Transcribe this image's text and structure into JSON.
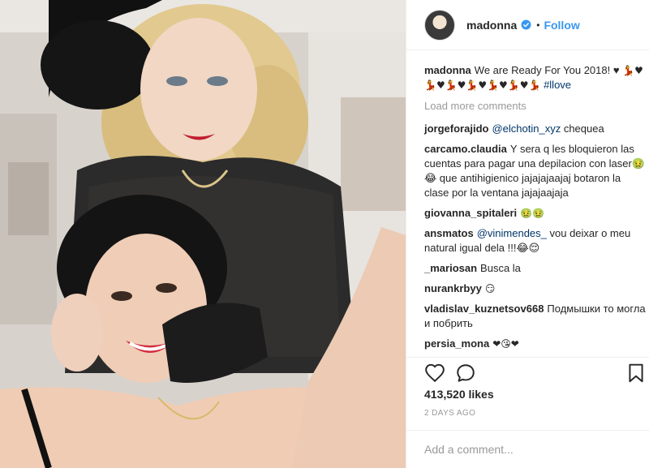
{
  "post": {
    "username": "madonna",
    "separator": "•",
    "follow_label": "Follow",
    "caption_user": "madonna",
    "caption_text": "We are Ready For You 2018! ♥",
    "caption_emojis": "💃♥💃♥💃♥💃♥💃♥💃♥💃",
    "caption_hashtag": "#llove",
    "load_more": "Load more comments",
    "likes": "413,520 likes",
    "time": "2 DAYS AGO",
    "add_comment_placeholder": "Add a comment..."
  },
  "comments": [
    {
      "user": "jorgeforajido",
      "mention": "@elchotin_xyz",
      "text": " chequea"
    },
    {
      "user": "carcamo.claudia",
      "mention": "",
      "text": "Y sera q les bloquieron las cuentas para pagar una depilacion con laser🤢😂 que antihigienico jajajajaajaj botaron la clase por la ventana jajajaajaja"
    },
    {
      "user": "giovanna_spitaleri",
      "mention": "",
      "text": "🤢🤢"
    },
    {
      "user": "ansmatos",
      "mention": "@vinimendes_",
      "text": " vou deixar o meu natural igual dela !!!😂😌"
    },
    {
      "user": "_mariosan",
      "mention": "",
      "text": "Busca la"
    },
    {
      "user": "nurankrbyy",
      "mention": "",
      "text": "😏"
    },
    {
      "user": "vladislav_kuznetsov668",
      "mention": "",
      "text": "Подмышки то могла и побрить"
    },
    {
      "user": "persia_mona",
      "mention": "",
      "text": "❤😘❤"
    }
  ],
  "icons": {
    "like": "heart-icon",
    "comment": "comment-icon",
    "save": "bookmark-icon",
    "verified": "verified-badge-icon"
  },
  "colors": {
    "link_blue": "#3897f0",
    "hashtag_blue": "#003569",
    "muted_gray": "#999999",
    "text_dark": "#262626"
  }
}
